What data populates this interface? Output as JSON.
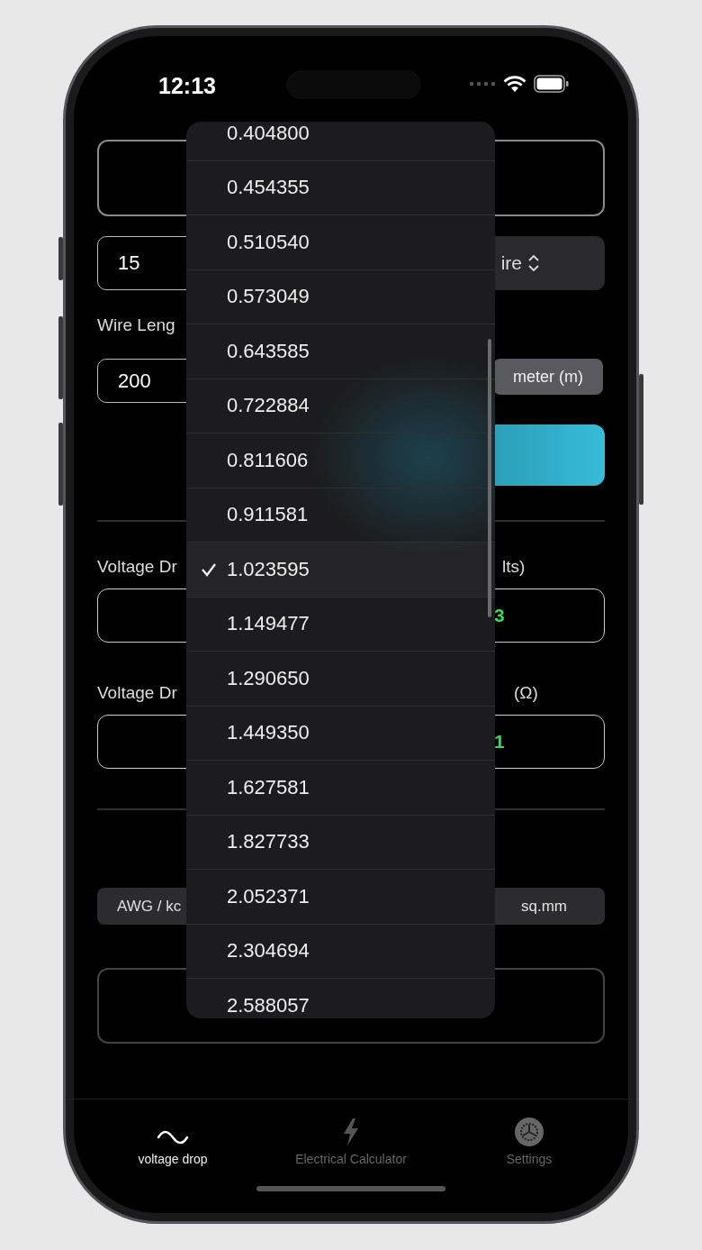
{
  "status_bar": {
    "time": "12:13"
  },
  "form": {
    "current_input": {
      "value": "15"
    },
    "wire_select": {
      "label": "ire"
    },
    "length_label": "Wire Leng",
    "length_input": {
      "value": "200"
    },
    "length_unit_button": {
      "label": "meter (m)"
    },
    "results": [
      {
        "label": "Voltage Dr",
        "unit_label": "lts)",
        "value": "3"
      },
      {
        "label": "Voltage Dr",
        "unit_label": "(Ω)",
        "value": "1"
      }
    ],
    "size_units": [
      "AWG / kc",
      "sq.mm"
    ]
  },
  "dropdown": {
    "items": [
      {
        "label": "0.404800",
        "selected": false
      },
      {
        "label": "0.454355",
        "selected": false
      },
      {
        "label": "0.510540",
        "selected": false
      },
      {
        "label": "0.573049",
        "selected": false
      },
      {
        "label": "0.643585",
        "selected": false
      },
      {
        "label": "0.722884",
        "selected": false
      },
      {
        "label": "0.811606",
        "selected": false
      },
      {
        "label": "0.911581",
        "selected": false
      },
      {
        "label": "1.023595",
        "selected": true
      },
      {
        "label": "1.149477",
        "selected": false
      },
      {
        "label": "1.290650",
        "selected": false
      },
      {
        "label": "1.449350",
        "selected": false
      },
      {
        "label": "1.627581",
        "selected": false
      },
      {
        "label": "1.827733",
        "selected": false
      },
      {
        "label": "2.052371",
        "selected": false
      },
      {
        "label": "2.304694",
        "selected": false
      },
      {
        "label": "2.588057",
        "selected": false
      }
    ]
  },
  "tab_bar": {
    "tabs": [
      {
        "label": "voltage drop",
        "selected": true
      },
      {
        "label": "Electrical Calculator",
        "selected": false
      },
      {
        "label": "Settings",
        "selected": false
      }
    ]
  }
}
